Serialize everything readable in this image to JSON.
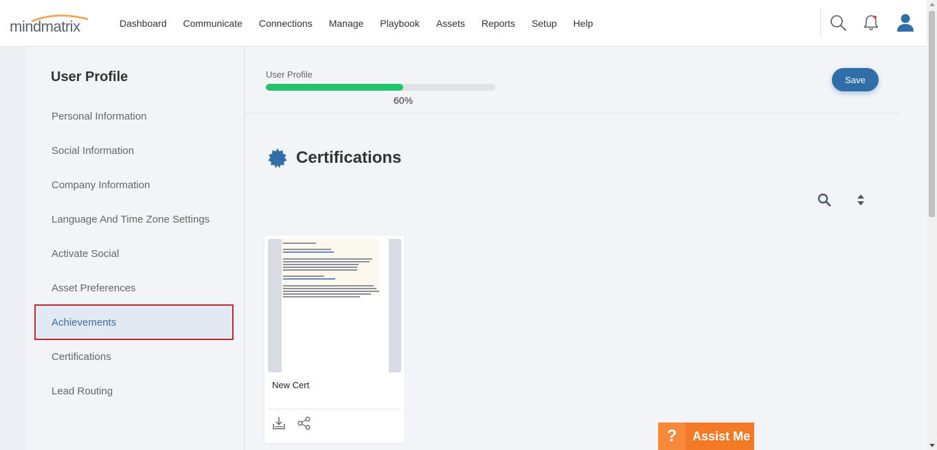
{
  "brand": {
    "logo_text": "mindmatrix",
    "accent": "#f4a13a"
  },
  "nav": {
    "items": [
      "Dashboard",
      "Communicate",
      "Connections",
      "Manage",
      "Playbook",
      "Assets",
      "Reports",
      "Setup",
      "Help"
    ]
  },
  "header_icons": [
    "search-icon",
    "bell-icon",
    "user-icon"
  ],
  "sidebar": {
    "title": "User Profile",
    "items": [
      {
        "label": "Personal Information",
        "active": false
      },
      {
        "label": "Social Information",
        "active": false
      },
      {
        "label": "Company Information",
        "active": false
      },
      {
        "label": "Language And Time Zone Settings",
        "active": false
      },
      {
        "label": "Activate Social",
        "active": false
      },
      {
        "label": "Asset Preferences",
        "active": false
      },
      {
        "label": "Achievements",
        "active": true
      },
      {
        "label": "Certifications",
        "active": false
      },
      {
        "label": "Lead Routing",
        "active": false
      }
    ]
  },
  "profile_progress": {
    "label": "User Profile",
    "value_percent": 60,
    "display": "60%",
    "fill_color": "#22c16b"
  },
  "actions": {
    "save_label": "Save"
  },
  "section": {
    "title": "Certifications",
    "icon": "badge-icon"
  },
  "toolbar_icons": [
    "search-icon",
    "sort-icon"
  ],
  "cards": [
    {
      "name": "New Cert",
      "actions": [
        "download-icon",
        "share-icon"
      ]
    }
  ],
  "assist": {
    "label": "Assist Me",
    "icon_glyph": "?"
  },
  "colors": {
    "primary": "#2f6ea9",
    "assist": "#f27a26",
    "active_border": "#c1272d"
  }
}
